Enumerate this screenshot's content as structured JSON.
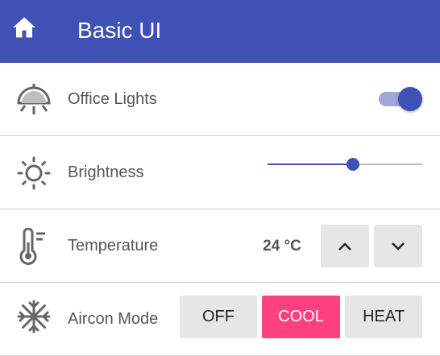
{
  "appbar": {
    "title": "Basic UI",
    "home_icon": "home-icon"
  },
  "rows": {
    "lights": {
      "label": "Office Lights",
      "icon": "ceiling-light-icon",
      "switch_on": true
    },
    "brightness": {
      "label": "Brightness",
      "icon": "sun-icon",
      "level_fraction": 0.55
    },
    "temperature": {
      "label": "Temperature",
      "icon": "thermometer-icon",
      "value": "24 °C",
      "up_icon": "chevron-up-icon",
      "down_icon": "chevron-down-icon"
    },
    "aircon": {
      "label": "Aircon Mode",
      "icon": "snowflake-icon",
      "modes": [
        "OFF",
        "COOL",
        "HEAT"
      ],
      "selected": "COOL"
    }
  },
  "colors": {
    "primary": "#3f51b5",
    "accent": "#ff4081",
    "primary_light": "#9fa8da"
  }
}
